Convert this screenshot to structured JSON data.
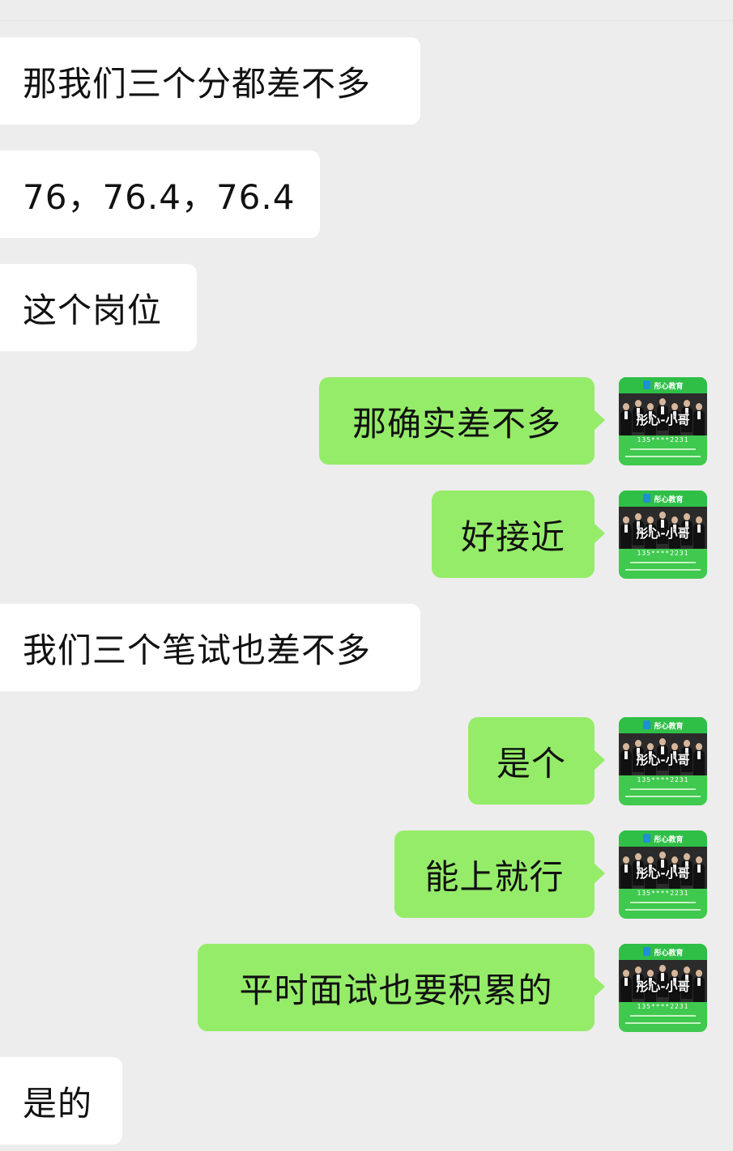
{
  "messages": [
    {
      "side": "in",
      "text": "那我们三个分都差不多"
    },
    {
      "side": "in",
      "text": "76，76.4，76.4"
    },
    {
      "side": "in",
      "text": "这个岗位"
    },
    {
      "side": "out",
      "text": "那确实差不多"
    },
    {
      "side": "out",
      "text": "好接近"
    },
    {
      "side": "in",
      "text": "我们三个笔试也差不多"
    },
    {
      "side": "out",
      "text": "是个"
    },
    {
      "side": "out",
      "text": "能上就行"
    },
    {
      "side": "out",
      "text": "平时面试也要积累的"
    },
    {
      "side": "in",
      "text": "是的"
    }
  ],
  "avatar": {
    "org": "彤心教育",
    "name": "彤心-小哥",
    "phone": "135****2231"
  },
  "colors": {
    "background": "#ededed",
    "incoming_bubble": "#ffffff",
    "outgoing_bubble": "#95ec69",
    "avatar_green": "#3fc94f"
  }
}
